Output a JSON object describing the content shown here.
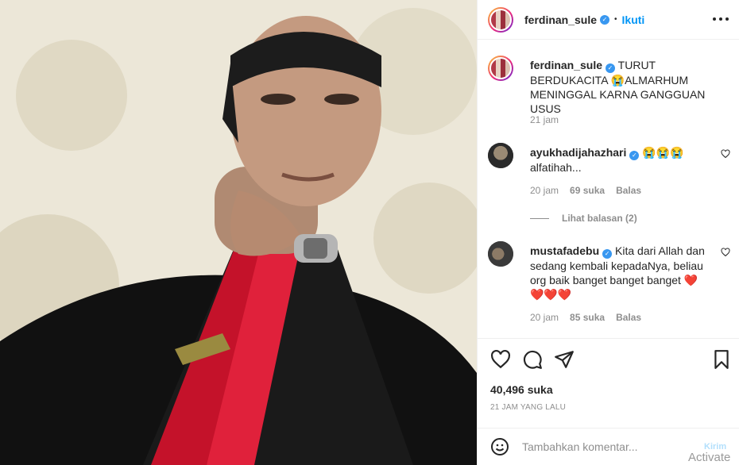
{
  "header": {
    "username": "ferdinan_sule",
    "separator": "•",
    "follow_label": "Ikuti"
  },
  "caption": {
    "username": "ferdinan_sule",
    "text": " TURUT BERDUKACITA 😭ALMARHUM MENINGGAL KARNA GANGGUAN USUS",
    "time": "21 jam"
  },
  "comments": [
    {
      "username": "ayukhadijahazhari",
      "text": " 😭😭😭 alfatihah...",
      "time": "20 jam",
      "likes": "69 suka",
      "reply_label": "Balas"
    },
    {
      "username": "mustafadebu",
      "text": " Kita dari Allah dan sedang kembali kepadaNya, beliau org baik banget banget banget ❤️ ❤️❤️❤️",
      "time": "20 jam",
      "likes": "85 suka",
      "reply_label": "Balas"
    }
  ],
  "view_replies": "Lihat balasan (2)",
  "likes_count": "40,496 suka",
  "post_time": "21 JAM YANG LALU",
  "add_comment": {
    "placeholder": "Tambahkan komentar...",
    "post_label": "Kirim"
  },
  "watermark": "Activate",
  "icons": {
    "verified": "verified-badge-icon",
    "like": "heart-icon",
    "comment": "comment-icon",
    "share": "share-icon",
    "save": "bookmark-icon",
    "emoji": "emoji-icon",
    "more": "more-options-icon"
  },
  "colors": {
    "accent": "#0095f6",
    "verified": "#3897f0",
    "muted": "#8e8e8e",
    "heart": "#ed4956"
  }
}
